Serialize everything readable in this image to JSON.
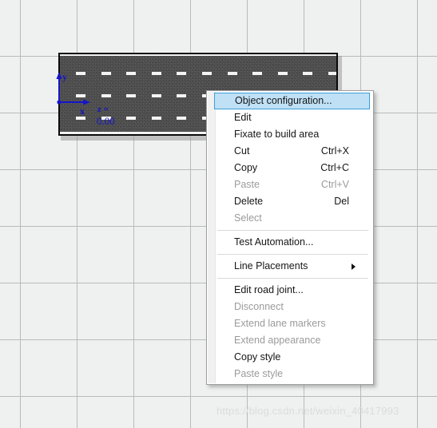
{
  "canvas": {
    "name": "road-editor-canvas",
    "grid_color": "#b9bbbb",
    "background_color": "#eff0f0",
    "grid_spacing_px": 71
  },
  "road_object": {
    "name": "road-segment",
    "surface_color": "#4b4b4b",
    "border_color": "#0b0b0b",
    "lane_marker_color": "#f4f4f4",
    "lane_rows": 3,
    "dashes_per_row": 11,
    "selected": true
  },
  "axis_gizmo": {
    "x_label": "x",
    "y_label": "y",
    "z_label": "z =",
    "z_value": "0.00",
    "color": "#1515c8"
  },
  "context_menu": {
    "highlight_fill": "#bfe0f5",
    "highlight_border": "#3c9fd6",
    "items": [
      {
        "label": "Object configuration...",
        "shortcut": "",
        "state": "highlighted",
        "submenu": false
      },
      {
        "label": "Edit",
        "shortcut": "",
        "state": "enabled",
        "submenu": false
      },
      {
        "label": "Fixate to build area",
        "shortcut": "",
        "state": "enabled",
        "submenu": false
      },
      {
        "label": "Cut",
        "shortcut": "Ctrl+X",
        "state": "enabled",
        "submenu": false
      },
      {
        "label": "Copy",
        "shortcut": "Ctrl+C",
        "state": "enabled",
        "submenu": false
      },
      {
        "label": "Paste",
        "shortcut": "Ctrl+V",
        "state": "disabled",
        "submenu": false
      },
      {
        "label": "Delete",
        "shortcut": "Del",
        "state": "enabled",
        "submenu": false
      },
      {
        "label": "Select",
        "shortcut": "",
        "state": "disabled",
        "submenu": false
      },
      {
        "separator": true
      },
      {
        "label": "Test Automation...",
        "shortcut": "",
        "state": "enabled",
        "submenu": false
      },
      {
        "separator": true
      },
      {
        "label": "Line Placements",
        "shortcut": "",
        "state": "enabled",
        "submenu": true
      },
      {
        "separator": true
      },
      {
        "label": "Edit road joint...",
        "shortcut": "",
        "state": "enabled",
        "submenu": false
      },
      {
        "label": "Disconnect",
        "shortcut": "",
        "state": "disabled",
        "submenu": false
      },
      {
        "label": "Extend lane markers",
        "shortcut": "",
        "state": "disabled",
        "submenu": false
      },
      {
        "label": "Extend appearance",
        "shortcut": "",
        "state": "disabled",
        "submenu": false
      },
      {
        "label": "Copy style",
        "shortcut": "",
        "state": "enabled",
        "submenu": false
      },
      {
        "label": "Paste style",
        "shortcut": "",
        "state": "disabled",
        "submenu": false
      }
    ]
  },
  "watermark": {
    "text": "https://blog.csdn.net/weixin_40417993"
  }
}
